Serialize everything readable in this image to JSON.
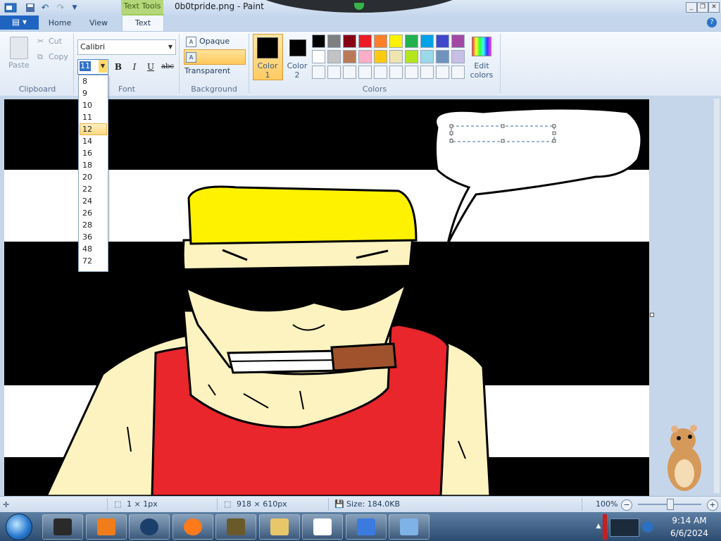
{
  "titlebar": {
    "title": "0b0tpride.png - Paint",
    "contextual_tab": "Text Tools",
    "qat_icons": [
      "save-icon",
      "undo-icon",
      "redo-icon",
      "customize-qat-icon"
    ],
    "window_buttons": [
      "minimize-icon",
      "restore-icon",
      "close-icon"
    ]
  },
  "tabs": [
    {
      "label": "Home"
    },
    {
      "label": "View"
    },
    {
      "label": "Text",
      "active": true
    }
  ],
  "ribbon": {
    "clipboard": {
      "label": "Clipboard",
      "paste": "Paste",
      "cut": "Cut",
      "copy": "Copy"
    },
    "font": {
      "label": "Font",
      "family": "Calibri",
      "size": "11",
      "bold": "B",
      "italic": "I",
      "underline": "U",
      "strikethrough": "abc"
    },
    "background": {
      "label": "Background",
      "opaque": "Opaque",
      "transparent": "Transparent",
      "selected": "Transparent"
    },
    "colors": {
      "label": "Colors",
      "color1_label": "Color\n1",
      "color1_line1": "Color",
      "color1_line2": "1",
      "color2_line1": "Color",
      "color2_line2": "2",
      "color1": "#000000",
      "color2": "#000000",
      "edit_line1": "Edit",
      "edit_line2": "colors",
      "palette": [
        "#000000",
        "#7f7f7f",
        "#880015",
        "#ed1c24",
        "#ff7f27",
        "#fff200",
        "#22b14c",
        "#00a2e8",
        "#3f48cc",
        "#a349a4",
        "#ffffff",
        "#c3c3c3",
        "#b97a57",
        "#ffaec9",
        "#ffc90e",
        "#efe4b0",
        "#b5e61d",
        "#99d9ea",
        "#7092be",
        "#c8bfe7",
        "#f3f6fa",
        "#f3f6fa",
        "#f3f6fa",
        "#f3f6fa",
        "#f3f6fa",
        "#f3f6fa",
        "#f3f6fa",
        "#f3f6fa",
        "#f3f6fa",
        "#f3f6fa"
      ]
    }
  },
  "size_dropdown": {
    "options": [
      "8",
      "9",
      "10",
      "11",
      "12",
      "14",
      "16",
      "18",
      "20",
      "22",
      "24",
      "26",
      "28",
      "36",
      "48",
      "72"
    ],
    "highlighted": "12"
  },
  "statusbar": {
    "selection_size": "1 × 1px",
    "canvas_size": "918 × 610px",
    "file_size": "Size: 184.0KB",
    "zoom": "100%",
    "zoom_level": 1.0
  },
  "taskbar": {
    "time": "9:14 AM",
    "date": "6/6/2024",
    "apps": [
      "terminal-app-icon",
      "media-player-app-icon",
      "dark-globe-app-icon",
      "firefox-app-icon",
      "bonzi-box-app-icon",
      "file-explorer-app-icon",
      "solitaire-app-icon",
      "blue-bird-app-icon",
      "paint-app-icon"
    ]
  }
}
